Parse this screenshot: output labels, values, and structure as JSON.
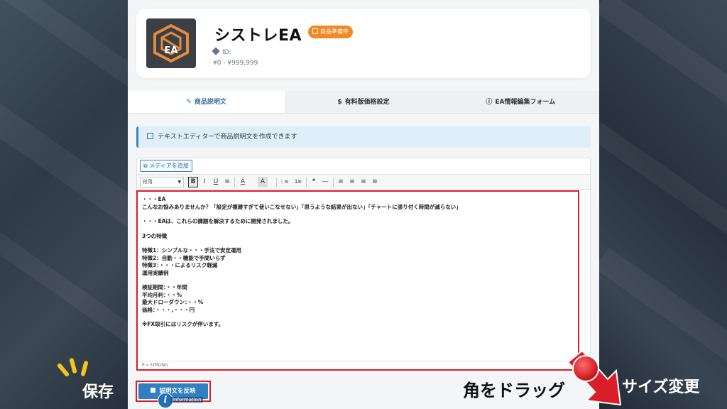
{
  "product": {
    "title": "シストレEA",
    "status_badge": "商品準備中",
    "id_label": "ID:",
    "price_range": "¥0 - ¥999,999",
    "thumb_text": "EA"
  },
  "tabs": [
    {
      "icon": "✎",
      "label": "商品説明文",
      "active": true
    },
    {
      "icon": "$",
      "label": "有料版価格設定",
      "active": false
    },
    {
      "icon": "ⓘ",
      "label": "EA情報編集フォーム",
      "active": false
    }
  ],
  "info_alert": "テキストエディターで商品説明文を作成できます",
  "editor": {
    "media_button": "メディアを追加",
    "format_select": "段落",
    "toolbar": [
      "B",
      "I",
      "U",
      "≡",
      "A",
      "A",
      "⋮≡",
      "1≡",
      "❝",
      "—",
      "≡",
      "≡",
      "≡",
      "≡"
    ],
    "content": [
      "・・・EA",
      "こんなお悩みありませんか？「設定が複雑すぎて使いこなせない」「思うような結果が出ない」「チャートに張り付く時間が減らない」",
      "",
      "・・・EAは、これらの課題を解決するために開発されました。",
      "",
      "3つの特徴",
      "",
      "特徴1：シンプルな・・・手法で安定運用",
      "特徴2：自動・・機能で手間いらず",
      "特徴3：・・・によるリスク軽減",
      "運用実績例",
      "",
      "検証期間：・・年間",
      "平均月利：・・%",
      "最大ドローダウン：・・%",
      "価格：・・・,・・・円",
      "",
      "※FX取引にはリスクが伴います。"
    ],
    "path": "P » STRONG"
  },
  "save": {
    "button": "説明文を反映",
    "info_text": "information"
  },
  "annotations": {
    "save": "保存",
    "drag": "角をドラッグ",
    "resize": "サイズ変更"
  },
  "colors": {
    "accent": "#2f7fc1",
    "badge": "#f08a24",
    "highlight": "#d91e2a"
  }
}
